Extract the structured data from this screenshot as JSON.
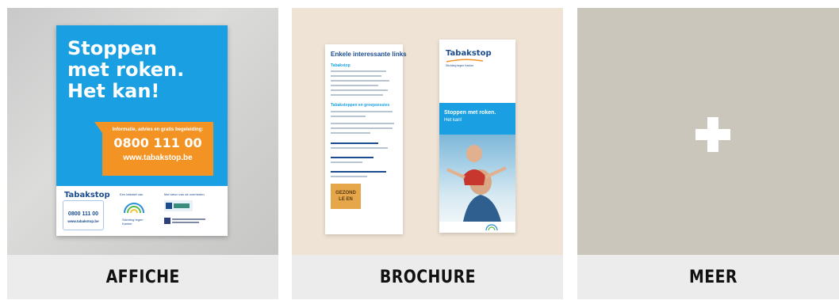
{
  "cards": [
    {
      "caption": "AFFICHE",
      "poster": {
        "headline": [
          "Stoppen",
          "met roken.",
          "Het kan!"
        ],
        "info": "Informatie, advies en gratis begeleiding:",
        "phone": "0800 111 00",
        "url": "www.tabakstop.be",
        "logo": "Tabakstop",
        "box_phone": "0800 111 00",
        "box_url": "www.tabakstop.be",
        "initiative_label": "Een initiatief van",
        "support_label": "Met steun van de overheden",
        "org": "Stichting tegen Kanker"
      },
      "colors": {
        "poster_blue": "#1aa0e2",
        "bubble_orange": "#f39323",
        "brand_navy": "#1a4c8e"
      }
    },
    {
      "caption": "BROCHURE",
      "brochure": {
        "left_title": "Enkele interessante links",
        "left_sub1": "Tabakstop",
        "left_sub2": "Tabakstoppen en groepsessies",
        "badge": [
          "GEZOND",
          "LE EN"
        ],
        "logo": "Tabakstop",
        "tagline": "Stichting tegen Kanker",
        "band_title": "Stoppen met roken.",
        "band_sub": "Het kan!"
      }
    },
    {
      "caption": "MEER",
      "icon": "plus-icon"
    }
  ]
}
